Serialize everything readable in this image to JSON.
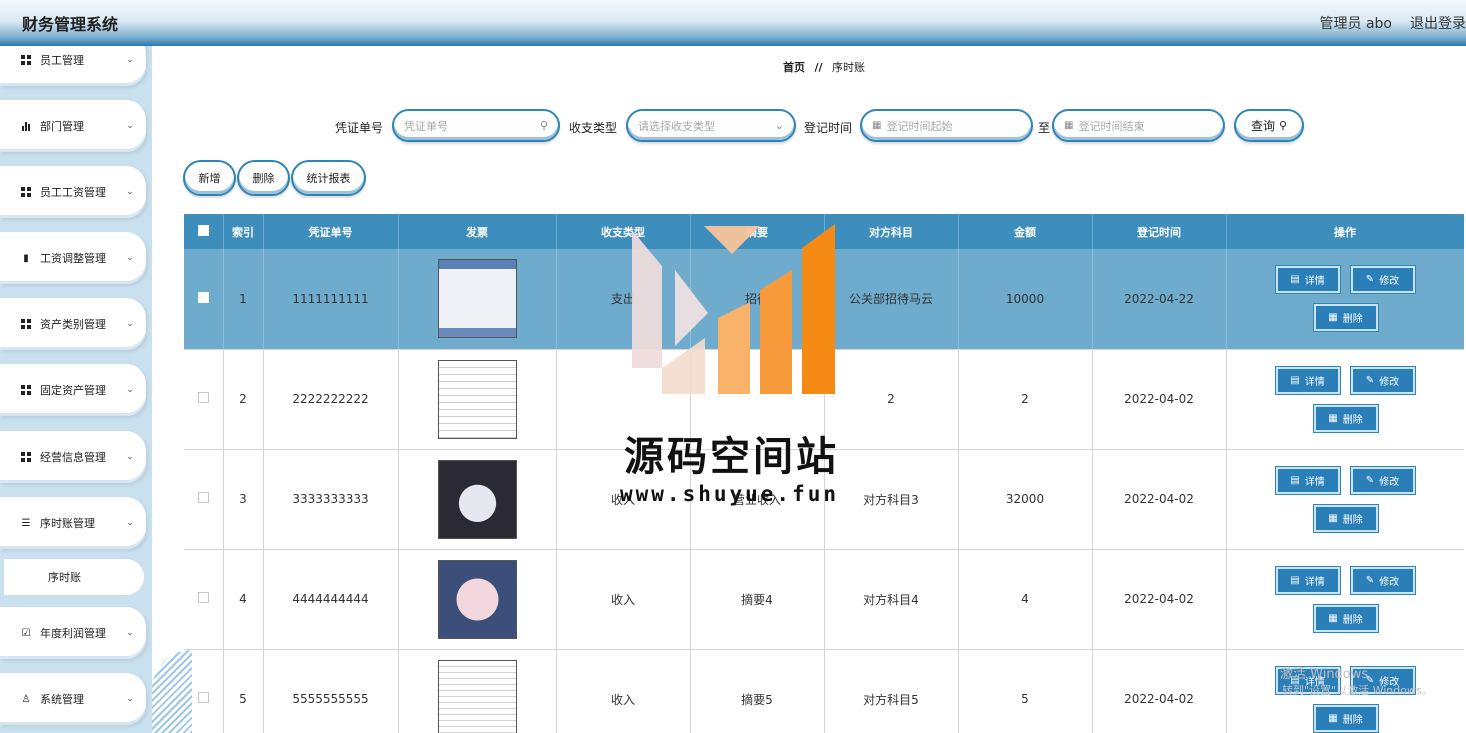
{
  "header": {
    "title": "财务管理系统",
    "admin": "管理员 abo",
    "logout": "退出登录"
  },
  "sidebar": {
    "items": [
      {
        "label": "员工管理",
        "icon": "grid-icon"
      },
      {
        "label": "部门管理",
        "icon": "bar-chart-icon"
      },
      {
        "label": "员工工资管理",
        "icon": "grid-icon"
      },
      {
        "label": "工资调整管理",
        "icon": "clipboard-icon"
      },
      {
        "label": "资产类别管理",
        "icon": "grid-icon"
      },
      {
        "label": "固定资产管理",
        "icon": "grid-icon"
      },
      {
        "label": "经营信息管理",
        "icon": "grid-icon"
      },
      {
        "label": "序时账管理",
        "icon": "list-icon"
      },
      {
        "label": "年度利润管理",
        "icon": "check-clipboard-icon"
      },
      {
        "label": "系统管理",
        "icon": "user-icon"
      }
    ],
    "sub_item": "序时账"
  },
  "breadcrumb": {
    "home": "首页",
    "sep": "//",
    "current": "序时账"
  },
  "search": {
    "voucher_label": "凭证单号",
    "voucher_placeholder": "凭证单号",
    "type_label": "收支类型",
    "type_placeholder": "请选择收支类型",
    "time_label": "登记时间",
    "time_start_placeholder": "登记时间起始",
    "to": "至",
    "time_end_placeholder": "登记时间结束",
    "query": "查询"
  },
  "actions": {
    "add": "新增",
    "delete": "删除",
    "report": "统计报表"
  },
  "table": {
    "columns": [
      "索引",
      "凭证单号",
      "发票",
      "收支类型",
      "摘要",
      "对方科目",
      "金额",
      "登记时间",
      "操作"
    ],
    "rows": [
      {
        "index": "1",
        "voucher": "1111111111",
        "type": "支出",
        "summary": "招待",
        "account": "公关部招待马云",
        "amount": "10000",
        "date": "2022-04-22"
      },
      {
        "index": "2",
        "voucher": "2222222222",
        "type": "",
        "summary": "",
        "account": "2",
        "amount": "2",
        "date": "2022-04-02"
      },
      {
        "index": "3",
        "voucher": "3333333333",
        "type": "收入",
        "summary": "营业收入",
        "account": "对方科目3",
        "amount": "32000",
        "date": "2022-04-02"
      },
      {
        "index": "4",
        "voucher": "4444444444",
        "type": "收入",
        "summary": "摘要4",
        "account": "对方科目4",
        "amount": "4",
        "date": "2022-04-02"
      },
      {
        "index": "5",
        "voucher": "5555555555",
        "type": "收入",
        "summary": "摘要5",
        "account": "对方科目5",
        "amount": "5",
        "date": "2022-04-02"
      }
    ],
    "ops": {
      "detail": "详情",
      "edit": "修改",
      "delete": "删除"
    }
  },
  "watermark": {
    "name": "源码空间站",
    "url": "www.shuyue.fun"
  },
  "overlay": {
    "activation": "激活 Windows",
    "activation_hint": "转到\"设置\"以激活 Windows。"
  },
  "colors": {
    "accent": "#2a7fb8",
    "header_blue": "#2a78ad",
    "selected_row": "#6fabcd",
    "sidebar_bg": "#c9e0ef"
  }
}
